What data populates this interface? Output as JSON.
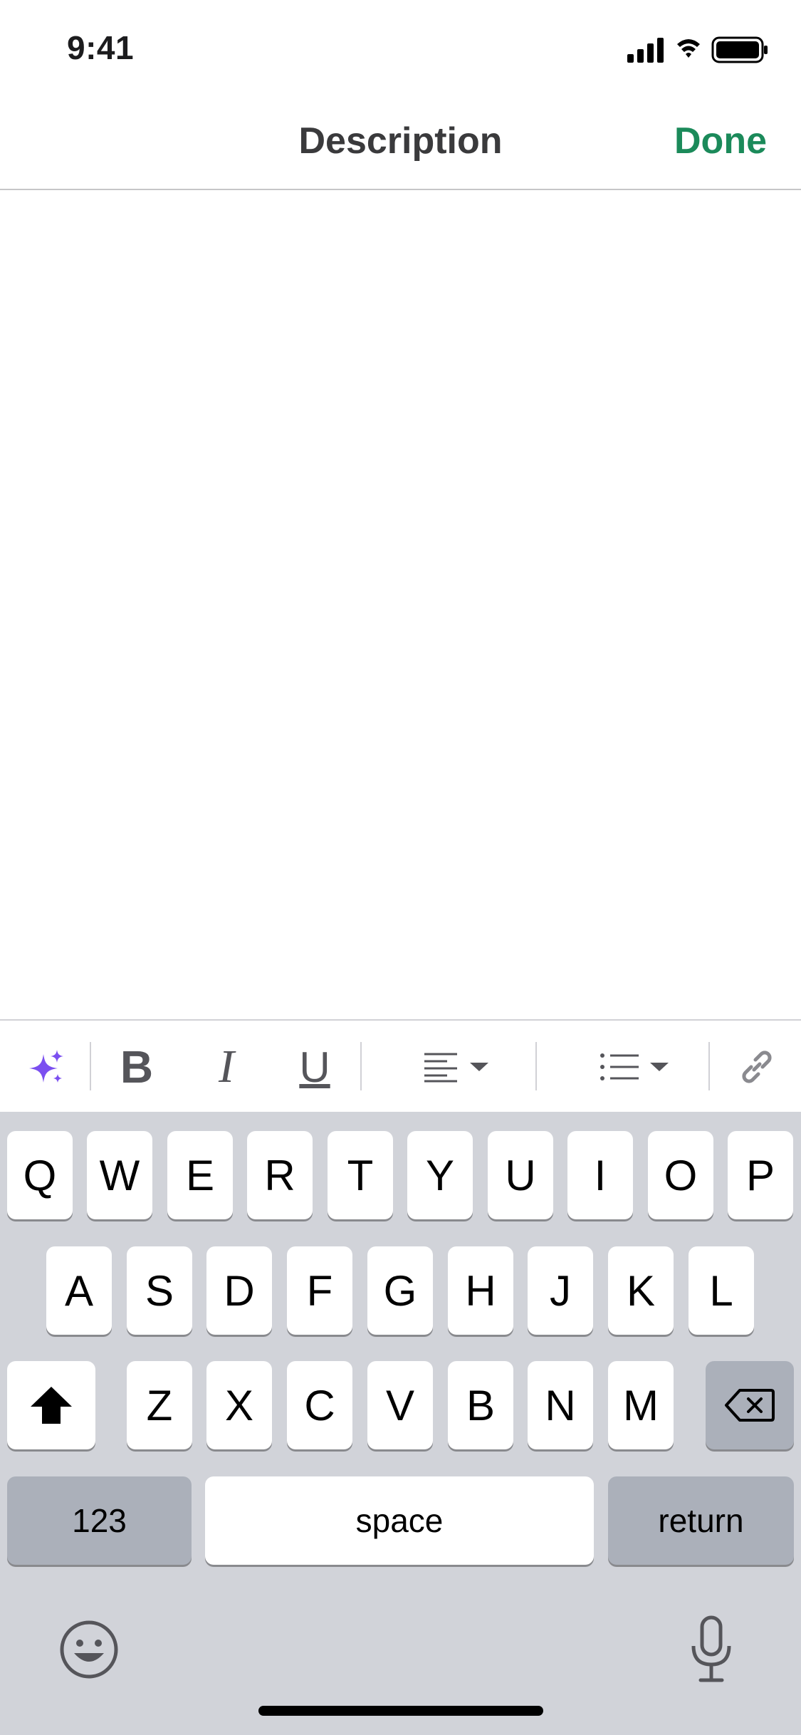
{
  "status_bar": {
    "time": "9:41"
  },
  "nav": {
    "title": "Description",
    "done_label": "Done"
  },
  "editor": {
    "value": ""
  },
  "toolbar": {
    "items": [
      "ai-sparkle",
      "bold",
      "italic",
      "underline",
      "align",
      "list",
      "link"
    ],
    "bold_label": "B",
    "italic_label": "I",
    "underline_label": "U",
    "accent_color": "#7b4ff0"
  },
  "keyboard": {
    "row1": [
      "Q",
      "W",
      "E",
      "R",
      "T",
      "Y",
      "U",
      "I",
      "O",
      "P"
    ],
    "row2": [
      "A",
      "S",
      "D",
      "F",
      "G",
      "H",
      "J",
      "K",
      "L"
    ],
    "row3": [
      "Z",
      "X",
      "C",
      "V",
      "B",
      "N",
      "M"
    ],
    "numbers_label": "123",
    "space_label": "space",
    "return_label": "return"
  },
  "colors": {
    "done": "#1b8a5a",
    "keyboard_bg": "#d1d3d9"
  }
}
